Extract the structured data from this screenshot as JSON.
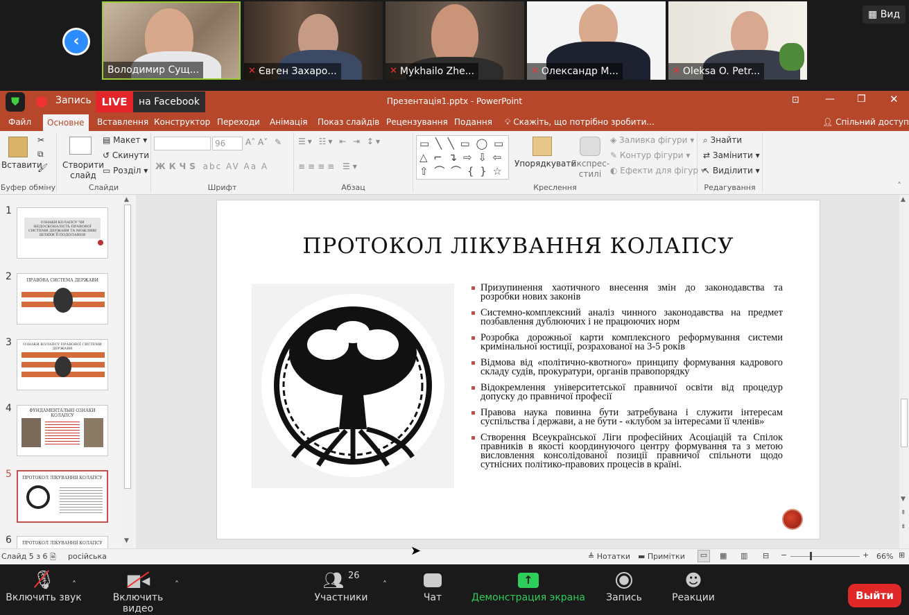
{
  "participants": [
    {
      "name": "Володимир Сущ...",
      "muted": false
    },
    {
      "name": "Євген Захаро...",
      "muted": true
    },
    {
      "name": "Mykhailo Zhe...",
      "muted": true
    },
    {
      "name": "Олександр М...",
      "muted": true
    },
    {
      "name": "Oleksa O. Petr...",
      "muted": true
    }
  ],
  "view_label": "Вид",
  "recording": {
    "label": "Запись",
    "live": "LIVE",
    "platform": "на Facebook"
  },
  "window_title": "Презентація1.pptx - PowerPoint",
  "menu": [
    "Файл",
    "Основне",
    "Вставлення",
    "Конструктор",
    "Переходи",
    "Анімація",
    "Показ слайдів",
    "Рецензування",
    "Подання"
  ],
  "tell_me": "Скажіть, що потрібно зробити...",
  "share": "Спільний доступ",
  "ribbon": {
    "paste": "Вставити",
    "clipboard": "Буфер обміну",
    "new_slide": "Створити слайд",
    "layout": "Макет",
    "reset": "Скинути",
    "section": "Розділ",
    "slides": "Слайди",
    "font_size": "96",
    "font": "Шрифт",
    "paragraph": "Абзац",
    "arrange": "Упорядкувати",
    "quick_styles": "Експрес-стилі",
    "fill": "Заливка фігури",
    "outline": "Контур фігури",
    "effects": "Ефекти для фігур",
    "drawing": "Креслення",
    "find": "Знайти",
    "replace": "Замінити",
    "select": "Виділити",
    "editing": "Редагування"
  },
  "thumbnails": [
    {
      "num": "1",
      "title": "ОЗНАКИ КОЛАПСУ ЧИ НЕДОСКОНАЛІСТЬ ПРАВОВОЇ СИСТЕМИ ДЕРЖАВИ ТА МОЖЛИВІ ШЛЯХИ ЇЇ ПОДОЛАННЯ"
    },
    {
      "num": "2",
      "title": "ПРАВОВА СИСТЕМА ДЕРЖАВИ"
    },
    {
      "num": "3",
      "title": "ОЗНАКИ КОЛАПСУ ПРАВОВОЇ СИСТЕМИ ДЕРЖАВИ"
    },
    {
      "num": "4",
      "title": "ФУНДАМЕНТАЛЬНІ ОЗНАКИ КОЛАПСУ"
    },
    {
      "num": "5",
      "title": "ПРОТОКОЛ ЛІКУВАННЯ КОЛАПСУ"
    },
    {
      "num": "6",
      "title": "ПРОТОКОЛ ЛІКУВАННЯ КОЛАПСУ"
    }
  ],
  "slide": {
    "title": "ПРОТОКОЛ ЛІКУВАННЯ КОЛАПСУ",
    "bullets": [
      "Призупинення  хаотичного внесення змін до законодавства та розробки нових законів",
      "Системно-комплексний аналіз чинного законодавства на предмет позбавлення дублюючих і не працюючих норм",
      "Розробка дорожньої карти комплексного  реформування системи кримінальної юстиції, розрахованої на 3-5 років",
      "Відмова від «політично-квотного» принципу  формування кадрового складу судів, прокуратури, органів правопорядку",
      "Відокремлення університетської правничої освіти від процедур допуску до правничої професії",
      "Правова наука повинна бути затребувана і служити інтересам суспільства і держави, а не бути - «клубом за інтересами її членів»",
      "Створення Всеукраїнської Ліги  професійних Асоціацій та Спілок правників в якості координуючого центру формування та з метою висловлення консолідованої позиції правничої спільноти щодо сутнісних політико-правових процесів в країні."
    ]
  },
  "status": {
    "slide": "Слайд 5 з 6",
    "language": "російська",
    "notes": "Нотатки",
    "comments": "Примітки",
    "zoom": "66%"
  },
  "toolbar": {
    "audio": "Включить звук",
    "video": "Включить видео",
    "participants": "Участники",
    "participants_count": "26",
    "chat": "Чат",
    "share": "Демонстрация экрана",
    "record": "Запись",
    "reactions": "Реакции",
    "leave": "Выйти"
  }
}
